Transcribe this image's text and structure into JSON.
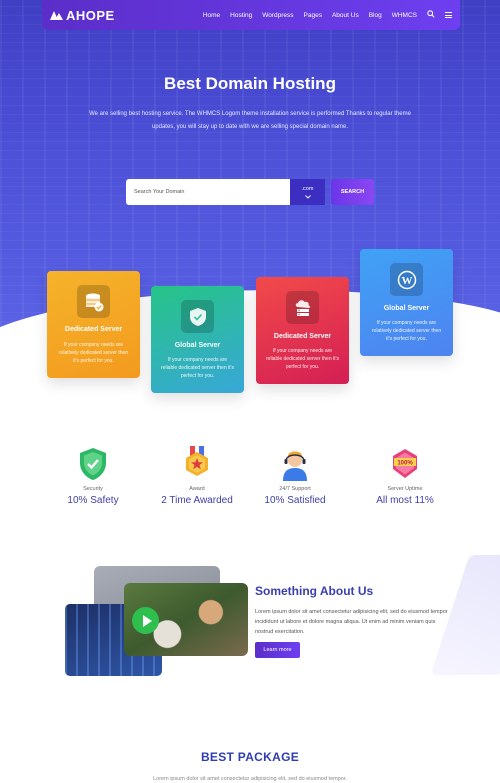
{
  "nav": {
    "logo": "AHOPE",
    "links": [
      "Home",
      "Hosting",
      "Wordpress",
      "Pages",
      "About Us",
      "Blog",
      "WHMCS"
    ]
  },
  "hero": {
    "title": "Best Domain Hosting",
    "description": "We are selling best hosting service. The WHMCS Logom theme installation service is performed Thanks to regular theme updates, you will stay up to date with we are selling special domain name.",
    "search_placeholder": "Search Your Domain",
    "tld": ".com",
    "search_button": "SEARCH"
  },
  "cards": [
    {
      "title": "Dedicated Server",
      "text": "If your company needs are relatively dedicated server then it's perfect for you.",
      "icon": "database-check-icon",
      "color": "#f5a623"
    },
    {
      "title": "Global Server",
      "text": "If your company needs are reliable dedicated server then it's perfect for you.",
      "icon": "shield-check-icon",
      "color": "#2ec4a0"
    },
    {
      "title": "Dedicated Server",
      "text": "If your company needs are reliable dedicated server then it's perfect for you.",
      "icon": "cloud-server-icon",
      "color": "#e8344f"
    },
    {
      "title": "Global Server",
      "text": "If your company needs are relatively dedicated server then it's perfect for you.",
      "icon": "wordpress-icon",
      "color": "#4a90f0"
    }
  ],
  "stats": [
    {
      "label": "Security",
      "value": "10% Safety",
      "icon": "shield-check-icon"
    },
    {
      "label": "Award",
      "value": "2 Time Awarded",
      "icon": "award-medal-icon"
    },
    {
      "label": "24/7 Support",
      "value": "10% Satisfied",
      "icon": "support-agent-icon"
    },
    {
      "label": "Server Uptime",
      "value": "All most 11%",
      "icon": "uptime-badge-icon"
    }
  ],
  "about": {
    "title": "Something About Us",
    "text": "Lorem ipsum dolor sit amet consectetur adipisicing elit, sed do eiusmod tempor incididunt ut labore et dolore magna aliqua. Ut enim ad minim veniam quis nostrud exercitation.",
    "button": "Learn more"
  },
  "package": {
    "title": "BEST PACKAGE",
    "subtitle": "Lorem ipsum dolor sit amet consectetur adipisicing elit, sed do eiusmod tempor."
  }
}
